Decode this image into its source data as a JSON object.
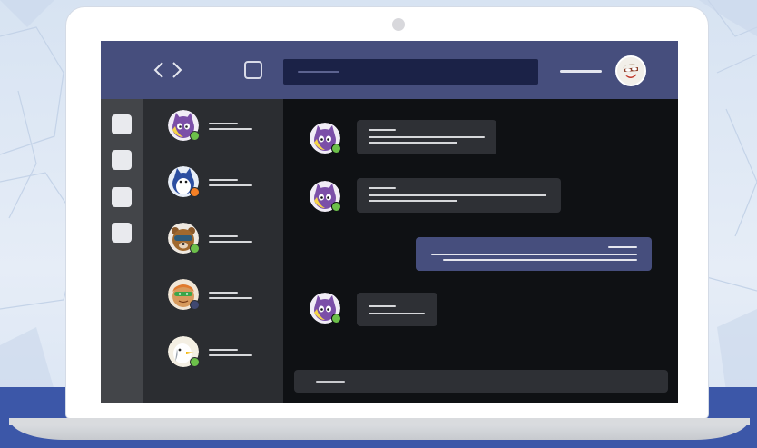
{
  "scene": {
    "description_label": "",
    "colors": {
      "background_band": "#3c57a8",
      "topbar": "#464e7d",
      "search_field": "#1b2247",
      "app_rail": "#434549",
      "chat_list": "#2b2d31",
      "conversation": "#0f1114",
      "incoming_bubble": "#2e3035",
      "outgoing_bubble": "#464e7d",
      "status_available": "#6cc04a",
      "status_away": "#f58025",
      "status_offline": "#404870"
    }
  },
  "topbar": {
    "code_icon": "code-brackets-icon",
    "window_icon": "square-icon",
    "search_placeholder": "",
    "user_avatar_icon": "user-avatar"
  },
  "app_rail": {
    "items": [
      {
        "icon": "app-square-icon"
      },
      {
        "icon": "app-square-icon"
      },
      {
        "icon": "app-square-icon"
      },
      {
        "icon": "app-square-icon"
      }
    ]
  },
  "chat_list": {
    "items": [
      {
        "avatar": "purple-cat-avatar",
        "status": "available"
      },
      {
        "avatar": "blue-creature-avatar",
        "status": "away"
      },
      {
        "avatar": "raccoon-avatar",
        "status": "available"
      },
      {
        "avatar": "frog-hero-avatar",
        "status": "offline"
      },
      {
        "avatar": "seagull-avatar",
        "status": "available"
      }
    ]
  },
  "conversation": {
    "messages": [
      {
        "sender": "other",
        "avatar": "purple-cat-avatar"
      },
      {
        "sender": "other",
        "avatar": "purple-cat-avatar"
      },
      {
        "sender": "me"
      },
      {
        "sender": "other",
        "avatar": "purple-cat-avatar"
      }
    ],
    "compose_placeholder": ""
  }
}
